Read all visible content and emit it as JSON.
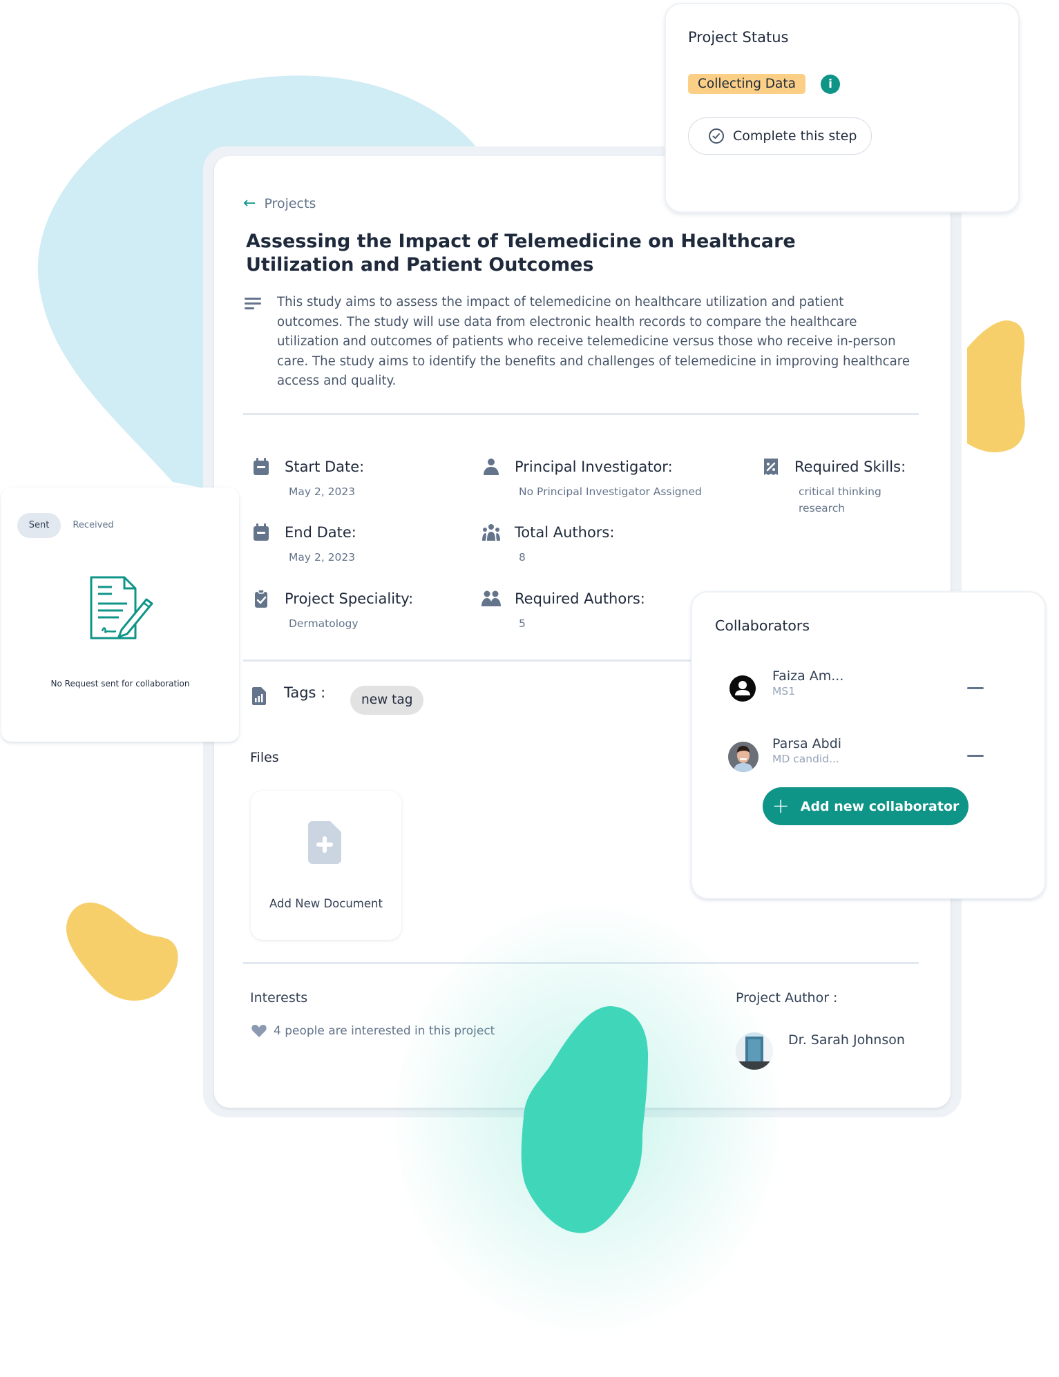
{
  "breadcrumb": {
    "back_label": "Projects"
  },
  "project": {
    "title": "Assessing the Impact of Telemedicine on Healthcare Utilization and Patient Outcomes",
    "description": "This study aims to assess the impact of telemedicine on healthcare utilization and patient outcomes. The study will use data from electronic health records to compare the healthcare utilization and outcomes of patients who receive telemedicine versus those who receive in-person care. The study aims to identify the benefits and challenges of telemedicine in improving healthcare access and quality."
  },
  "details": {
    "start_date": {
      "label": "Start Date:",
      "value": "May 2, 2023",
      "icon": "calendar-icon"
    },
    "end_date": {
      "label": "End Date:",
      "value": "May 2, 2023",
      "icon": "calendar-icon"
    },
    "speciality": {
      "label": "Project Speciality:",
      "value": "Dermatology",
      "icon": "clipboard-check-icon"
    },
    "principal_investigator": {
      "label": "Principal Investigator:",
      "value": "No Principal Investigator Assigned",
      "icon": "person-icon"
    },
    "total_authors": {
      "label": "Total Authors:",
      "value": "8",
      "icon": "group-icon"
    },
    "required_authors": {
      "label": "Required Authors:",
      "value": "5",
      "icon": "people-icon"
    },
    "required_skills": {
      "label": "Required Skills:",
      "values": [
        "critical thinking",
        "research"
      ],
      "icon": "badge-percent-icon"
    }
  },
  "tags": {
    "label": "Tags :",
    "items": [
      "new tag"
    ]
  },
  "files": {
    "label": "Files",
    "add_document_label": "Add New Document"
  },
  "interests": {
    "label": "Interests",
    "text": "4 people are interested in this project"
  },
  "author": {
    "label": "Project Author :",
    "name": "Dr. Sarah Johnson"
  },
  "status": {
    "title": "Project Status",
    "badge": "Collecting Data",
    "info_icon_glyph": "i",
    "complete_button": "Complete this step"
  },
  "requests": {
    "tabs": [
      {
        "label": "Sent",
        "active": true
      },
      {
        "label": "Received",
        "active": false
      }
    ],
    "empty_message": "No Request sent for collaboration"
  },
  "collaborators": {
    "title": "Collaborators",
    "items": [
      {
        "name": "Faiza Am...",
        "role": "MS1",
        "avatar": "default-user"
      },
      {
        "name": "Parsa Abdi",
        "role": "MD candid...",
        "avatar": "photo"
      }
    ],
    "add_button": "Add new collaborator"
  },
  "colors": {
    "accent": "#0f9488",
    "status_badge": "#fbcf85",
    "blob_blue": "#d0ecf4",
    "blob_yellow": "#f7cf6a",
    "blob_teal": "#3fd6ba"
  }
}
